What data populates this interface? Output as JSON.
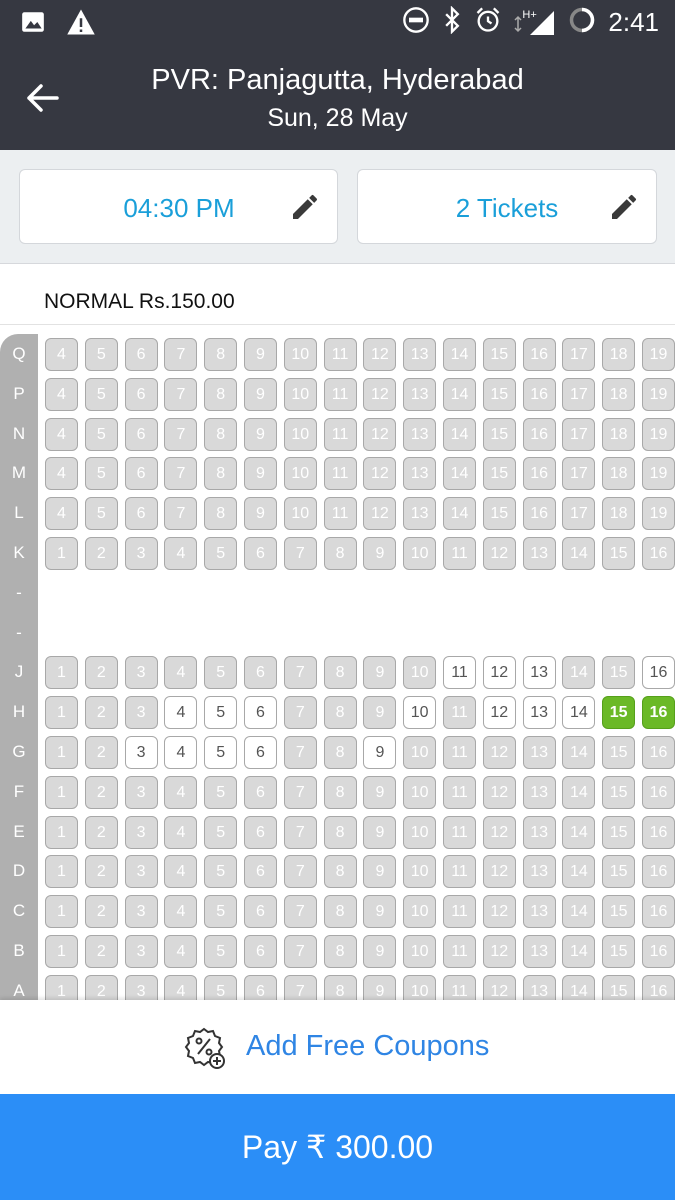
{
  "status_bar": {
    "time": "2:41",
    "icons_left": [
      "image-icon",
      "warning-icon"
    ],
    "icons_right": [
      "do-not-disturb-icon",
      "bluetooth-icon",
      "alarm-icon",
      "signal-icon",
      "battery-icon"
    ],
    "network": "H+"
  },
  "header": {
    "title": "PVR: Panjagutta, Hyderabad",
    "subtitle": "Sun, 28 May",
    "back_icon": "back-arrow-icon"
  },
  "selectors": {
    "showtime": "04:30 PM",
    "tickets": "2 Tickets",
    "edit_icon": "pencil-icon"
  },
  "category": {
    "label": "NORMAL Rs.150.00"
  },
  "seat_layout": {
    "rows": [
      {
        "label": "Q",
        "seats": [
          {
            "n": "4",
            "s": "sold"
          },
          {
            "n": "5",
            "s": "sold"
          },
          {
            "n": "6",
            "s": "sold"
          },
          {
            "n": "7",
            "s": "sold"
          },
          {
            "n": "8",
            "s": "sold"
          },
          {
            "n": "9",
            "s": "sold"
          },
          {
            "n": "10",
            "s": "sold"
          },
          {
            "n": "11",
            "s": "sold"
          },
          {
            "n": "12",
            "s": "sold"
          },
          {
            "n": "13",
            "s": "sold"
          },
          {
            "n": "14",
            "s": "sold"
          },
          {
            "n": "15",
            "s": "sold"
          },
          {
            "n": "16",
            "s": "sold"
          },
          {
            "n": "17",
            "s": "sold"
          },
          {
            "n": "18",
            "s": "sold"
          },
          {
            "n": "19",
            "s": "sold"
          }
        ]
      },
      {
        "label": "P",
        "seats": [
          {
            "n": "4",
            "s": "sold"
          },
          {
            "n": "5",
            "s": "sold"
          },
          {
            "n": "6",
            "s": "sold"
          },
          {
            "n": "7",
            "s": "sold"
          },
          {
            "n": "8",
            "s": "sold"
          },
          {
            "n": "9",
            "s": "sold"
          },
          {
            "n": "10",
            "s": "sold"
          },
          {
            "n": "11",
            "s": "sold"
          },
          {
            "n": "12",
            "s": "sold"
          },
          {
            "n": "13",
            "s": "sold"
          },
          {
            "n": "14",
            "s": "sold"
          },
          {
            "n": "15",
            "s": "sold"
          },
          {
            "n": "16",
            "s": "sold"
          },
          {
            "n": "17",
            "s": "sold"
          },
          {
            "n": "18",
            "s": "sold"
          },
          {
            "n": "19",
            "s": "sold"
          }
        ]
      },
      {
        "label": "N",
        "seats": [
          {
            "n": "4",
            "s": "sold"
          },
          {
            "n": "5",
            "s": "sold"
          },
          {
            "n": "6",
            "s": "sold"
          },
          {
            "n": "7",
            "s": "sold"
          },
          {
            "n": "8",
            "s": "sold"
          },
          {
            "n": "9",
            "s": "sold"
          },
          {
            "n": "10",
            "s": "sold"
          },
          {
            "n": "11",
            "s": "sold"
          },
          {
            "n": "12",
            "s": "sold"
          },
          {
            "n": "13",
            "s": "sold"
          },
          {
            "n": "14",
            "s": "sold"
          },
          {
            "n": "15",
            "s": "sold"
          },
          {
            "n": "16",
            "s": "sold"
          },
          {
            "n": "17",
            "s": "sold"
          },
          {
            "n": "18",
            "s": "sold"
          },
          {
            "n": "19",
            "s": "sold"
          }
        ]
      },
      {
        "label": "M",
        "seats": [
          {
            "n": "4",
            "s": "sold"
          },
          {
            "n": "5",
            "s": "sold"
          },
          {
            "n": "6",
            "s": "sold"
          },
          {
            "n": "7",
            "s": "sold"
          },
          {
            "n": "8",
            "s": "sold"
          },
          {
            "n": "9",
            "s": "sold"
          },
          {
            "n": "10",
            "s": "sold"
          },
          {
            "n": "11",
            "s": "sold"
          },
          {
            "n": "12",
            "s": "sold"
          },
          {
            "n": "13",
            "s": "sold"
          },
          {
            "n": "14",
            "s": "sold"
          },
          {
            "n": "15",
            "s": "sold"
          },
          {
            "n": "16",
            "s": "sold"
          },
          {
            "n": "17",
            "s": "sold"
          },
          {
            "n": "18",
            "s": "sold"
          },
          {
            "n": "19",
            "s": "sold"
          }
        ]
      },
      {
        "label": "L",
        "seats": [
          {
            "n": "4",
            "s": "sold"
          },
          {
            "n": "5",
            "s": "sold"
          },
          {
            "n": "6",
            "s": "sold"
          },
          {
            "n": "7",
            "s": "sold"
          },
          {
            "n": "8",
            "s": "sold"
          },
          {
            "n": "9",
            "s": "sold"
          },
          {
            "n": "10",
            "s": "sold"
          },
          {
            "n": "11",
            "s": "sold"
          },
          {
            "n": "12",
            "s": "sold"
          },
          {
            "n": "13",
            "s": "sold"
          },
          {
            "n": "14",
            "s": "sold"
          },
          {
            "n": "15",
            "s": "sold"
          },
          {
            "n": "16",
            "s": "sold"
          },
          {
            "n": "17",
            "s": "sold"
          },
          {
            "n": "18",
            "s": "sold"
          },
          {
            "n": "19",
            "s": "sold"
          }
        ]
      },
      {
        "label": "K",
        "seats": [
          {
            "n": "1",
            "s": "sold"
          },
          {
            "n": "2",
            "s": "sold"
          },
          {
            "n": "3",
            "s": "sold"
          },
          {
            "n": "4",
            "s": "sold"
          },
          {
            "n": "5",
            "s": "sold"
          },
          {
            "n": "6",
            "s": "sold"
          },
          {
            "n": "7",
            "s": "sold"
          },
          {
            "n": "8",
            "s": "sold"
          },
          {
            "n": "9",
            "s": "sold"
          },
          {
            "n": "10",
            "s": "sold"
          },
          {
            "n": "11",
            "s": "sold"
          },
          {
            "n": "12",
            "s": "sold"
          },
          {
            "n": "13",
            "s": "sold"
          },
          {
            "n": "14",
            "s": "sold"
          },
          {
            "n": "15",
            "s": "sold"
          },
          {
            "n": "16",
            "s": "sold"
          }
        ]
      },
      {
        "label": "-",
        "seats": []
      },
      {
        "label": "-",
        "seats": []
      },
      {
        "label": "J",
        "seats": [
          {
            "n": "1",
            "s": "sold"
          },
          {
            "n": "2",
            "s": "sold"
          },
          {
            "n": "3",
            "s": "sold"
          },
          {
            "n": "4",
            "s": "sold"
          },
          {
            "n": "5",
            "s": "sold"
          },
          {
            "n": "6",
            "s": "sold"
          },
          {
            "n": "7",
            "s": "sold"
          },
          {
            "n": "8",
            "s": "sold"
          },
          {
            "n": "9",
            "s": "sold"
          },
          {
            "n": "10",
            "s": "sold"
          },
          {
            "n": "11",
            "s": "avail"
          },
          {
            "n": "12",
            "s": "avail"
          },
          {
            "n": "13",
            "s": "avail"
          },
          {
            "n": "14",
            "s": "sold"
          },
          {
            "n": "15",
            "s": "sold"
          },
          {
            "n": "16",
            "s": "avail"
          }
        ]
      },
      {
        "label": "H",
        "seats": [
          {
            "n": "1",
            "s": "sold"
          },
          {
            "n": "2",
            "s": "sold"
          },
          {
            "n": "3",
            "s": "sold"
          },
          {
            "n": "4",
            "s": "avail"
          },
          {
            "n": "5",
            "s": "avail"
          },
          {
            "n": "6",
            "s": "avail"
          },
          {
            "n": "7",
            "s": "sold"
          },
          {
            "n": "8",
            "s": "sold"
          },
          {
            "n": "9",
            "s": "sold"
          },
          {
            "n": "10",
            "s": "avail"
          },
          {
            "n": "11",
            "s": "sold"
          },
          {
            "n": "12",
            "s": "avail"
          },
          {
            "n": "13",
            "s": "avail"
          },
          {
            "n": "14",
            "s": "avail"
          },
          {
            "n": "15",
            "s": "selected"
          },
          {
            "n": "16",
            "s": "selected"
          }
        ]
      },
      {
        "label": "G",
        "seats": [
          {
            "n": "1",
            "s": "sold"
          },
          {
            "n": "2",
            "s": "sold"
          },
          {
            "n": "3",
            "s": "avail"
          },
          {
            "n": "4",
            "s": "avail"
          },
          {
            "n": "5",
            "s": "avail"
          },
          {
            "n": "6",
            "s": "avail"
          },
          {
            "n": "7",
            "s": "sold"
          },
          {
            "n": "8",
            "s": "sold"
          },
          {
            "n": "9",
            "s": "avail"
          },
          {
            "n": "10",
            "s": "sold"
          },
          {
            "n": "11",
            "s": "sold"
          },
          {
            "n": "12",
            "s": "sold"
          },
          {
            "n": "13",
            "s": "sold"
          },
          {
            "n": "14",
            "s": "sold"
          },
          {
            "n": "15",
            "s": "sold"
          },
          {
            "n": "16",
            "s": "sold"
          }
        ]
      },
      {
        "label": "F",
        "seats": [
          {
            "n": "1",
            "s": "sold"
          },
          {
            "n": "2",
            "s": "sold"
          },
          {
            "n": "3",
            "s": "sold"
          },
          {
            "n": "4",
            "s": "sold"
          },
          {
            "n": "5",
            "s": "sold"
          },
          {
            "n": "6",
            "s": "sold"
          },
          {
            "n": "7",
            "s": "sold"
          },
          {
            "n": "8",
            "s": "sold"
          },
          {
            "n": "9",
            "s": "sold"
          },
          {
            "n": "10",
            "s": "sold"
          },
          {
            "n": "11",
            "s": "sold"
          },
          {
            "n": "12",
            "s": "sold"
          },
          {
            "n": "13",
            "s": "sold"
          },
          {
            "n": "14",
            "s": "sold"
          },
          {
            "n": "15",
            "s": "sold"
          },
          {
            "n": "16",
            "s": "sold"
          }
        ]
      },
      {
        "label": "E",
        "seats": [
          {
            "n": "1",
            "s": "sold"
          },
          {
            "n": "2",
            "s": "sold"
          },
          {
            "n": "3",
            "s": "sold"
          },
          {
            "n": "4",
            "s": "sold"
          },
          {
            "n": "5",
            "s": "sold"
          },
          {
            "n": "6",
            "s": "sold"
          },
          {
            "n": "7",
            "s": "sold"
          },
          {
            "n": "8",
            "s": "sold"
          },
          {
            "n": "9",
            "s": "sold"
          },
          {
            "n": "10",
            "s": "sold"
          },
          {
            "n": "11",
            "s": "sold"
          },
          {
            "n": "12",
            "s": "sold"
          },
          {
            "n": "13",
            "s": "sold"
          },
          {
            "n": "14",
            "s": "sold"
          },
          {
            "n": "15",
            "s": "sold"
          },
          {
            "n": "16",
            "s": "sold"
          }
        ]
      },
      {
        "label": "D",
        "seats": [
          {
            "n": "1",
            "s": "sold"
          },
          {
            "n": "2",
            "s": "sold"
          },
          {
            "n": "3",
            "s": "sold"
          },
          {
            "n": "4",
            "s": "sold"
          },
          {
            "n": "5",
            "s": "sold"
          },
          {
            "n": "6",
            "s": "sold"
          },
          {
            "n": "7",
            "s": "sold"
          },
          {
            "n": "8",
            "s": "sold"
          },
          {
            "n": "9",
            "s": "sold"
          },
          {
            "n": "10",
            "s": "sold"
          },
          {
            "n": "11",
            "s": "sold"
          },
          {
            "n": "12",
            "s": "sold"
          },
          {
            "n": "13",
            "s": "sold"
          },
          {
            "n": "14",
            "s": "sold"
          },
          {
            "n": "15",
            "s": "sold"
          },
          {
            "n": "16",
            "s": "sold"
          }
        ]
      },
      {
        "label": "C",
        "seats": [
          {
            "n": "1",
            "s": "sold"
          },
          {
            "n": "2",
            "s": "sold"
          },
          {
            "n": "3",
            "s": "sold"
          },
          {
            "n": "4",
            "s": "sold"
          },
          {
            "n": "5",
            "s": "sold"
          },
          {
            "n": "6",
            "s": "sold"
          },
          {
            "n": "7",
            "s": "sold"
          },
          {
            "n": "8",
            "s": "sold"
          },
          {
            "n": "9",
            "s": "sold"
          },
          {
            "n": "10",
            "s": "sold"
          },
          {
            "n": "11",
            "s": "sold"
          },
          {
            "n": "12",
            "s": "sold"
          },
          {
            "n": "13",
            "s": "sold"
          },
          {
            "n": "14",
            "s": "sold"
          },
          {
            "n": "15",
            "s": "sold"
          },
          {
            "n": "16",
            "s": "sold"
          }
        ]
      },
      {
        "label": "B",
        "seats": [
          {
            "n": "1",
            "s": "sold"
          },
          {
            "n": "2",
            "s": "sold"
          },
          {
            "n": "3",
            "s": "sold"
          },
          {
            "n": "4",
            "s": "sold"
          },
          {
            "n": "5",
            "s": "sold"
          },
          {
            "n": "6",
            "s": "sold"
          },
          {
            "n": "7",
            "s": "sold"
          },
          {
            "n": "8",
            "s": "sold"
          },
          {
            "n": "9",
            "s": "sold"
          },
          {
            "n": "10",
            "s": "sold"
          },
          {
            "n": "11",
            "s": "sold"
          },
          {
            "n": "12",
            "s": "sold"
          },
          {
            "n": "13",
            "s": "sold"
          },
          {
            "n": "14",
            "s": "sold"
          },
          {
            "n": "15",
            "s": "sold"
          },
          {
            "n": "16",
            "s": "sold"
          }
        ]
      },
      {
        "label": "A",
        "seats": [
          {
            "n": "1",
            "s": "sold"
          },
          {
            "n": "2",
            "s": "sold"
          },
          {
            "n": "3",
            "s": "sold"
          },
          {
            "n": "4",
            "s": "sold"
          },
          {
            "n": "5",
            "s": "sold"
          },
          {
            "n": "6",
            "s": "sold"
          },
          {
            "n": "7",
            "s": "sold"
          },
          {
            "n": "8",
            "s": "sold"
          },
          {
            "n": "9",
            "s": "sold"
          },
          {
            "n": "10",
            "s": "sold"
          },
          {
            "n": "11",
            "s": "sold"
          },
          {
            "n": "12",
            "s": "sold"
          },
          {
            "n": "13",
            "s": "sold"
          },
          {
            "n": "14",
            "s": "sold"
          },
          {
            "n": "15",
            "s": "sold"
          },
          {
            "n": "16",
            "s": "sold"
          }
        ]
      }
    ]
  },
  "coupon": {
    "label": "Add Free Coupons",
    "icon": "coupon-badge-icon"
  },
  "pay": {
    "label": "Pay ₹ 300.00"
  },
  "colors": {
    "header_bg": "#363841",
    "accent_blue": "#1a9fd9",
    "pay_bg": "#2b8ef7",
    "selected_seat": "#6bb927",
    "sold_seat": "#d9d9d9"
  }
}
